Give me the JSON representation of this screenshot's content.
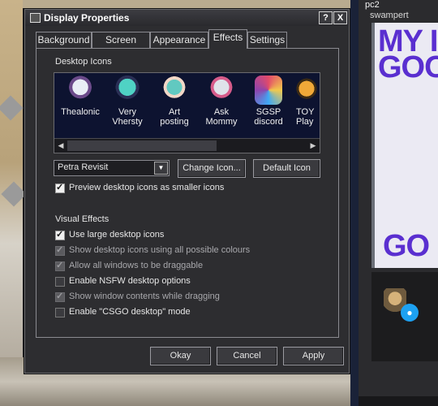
{
  "window": {
    "title": "Display Properties",
    "help_btn": "?",
    "close_btn": "X"
  },
  "tabs": [
    "Background",
    "Screen Saver",
    "Appearance",
    "Effects",
    "Settings"
  ],
  "active_tab": "Effects",
  "desktop_icons": {
    "heading": "Desktop Icons",
    "items": [
      {
        "label1": "Thealonic",
        "label2": "",
        "color": "#d8dde8"
      },
      {
        "label1": "Very",
        "label2": "Vhersty",
        "color": "#4fd2c4"
      },
      {
        "label1": "Art",
        "label2": "posting",
        "color": "#61c9c0"
      },
      {
        "label1": "Ask",
        "label2": "Mommy",
        "color": "#c9d0dc"
      },
      {
        "label1": "SGSP",
        "label2": "discord",
        "color": "#e24a6a"
      },
      {
        "label1": "TOY",
        "label2": "Play",
        "color": "#f0a838"
      }
    ],
    "selected_icon": "Petra Revisit",
    "change_icon_btn": "Change Icon...",
    "default_icon_btn": "Default Icon",
    "preview_smaller": {
      "label": "Preview desktop icons as smaller icons",
      "checked": true
    }
  },
  "visual_effects": {
    "heading": "Visual Effects",
    "options": [
      {
        "label": "Use large desktop icons",
        "checked": true,
        "enabled": true
      },
      {
        "label": "Show desktop icons using all possible colours",
        "checked": true,
        "enabled": false
      },
      {
        "label": "Allow all windows to be draggable",
        "checked": true,
        "enabled": false
      },
      {
        "label": "Enable NSFW desktop options",
        "checked": false,
        "enabled": true
      },
      {
        "label": "Show window contents while dragging",
        "checked": true,
        "enabled": false
      },
      {
        "label": "Enable \"CSGO desktop\" mode",
        "checked": false,
        "enabled": true
      }
    ]
  },
  "buttons": {
    "ok": "Okay",
    "cancel": "Cancel",
    "apply": "Apply"
  },
  "side_app": {
    "title": "pc2",
    "subtitle": "swampert",
    "banner_line1": "MY I",
    "banner_line2": "GOO",
    "banner_line3": "GO",
    "chat_icon": "●"
  }
}
